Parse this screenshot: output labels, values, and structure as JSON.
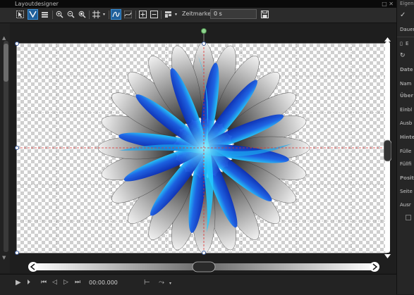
{
  "titlebar": {
    "title": "Layoutdesigner",
    "window_controls": "□ ✕"
  },
  "toolbar": {
    "zeitmarke_label": "Zeitmarke:",
    "zeitmarke_value": "0 s"
  },
  "bottombar": {
    "timecode": "00:00.000"
  },
  "right_panel": {
    "title": "Eigens",
    "tab": "Dauer",
    "doc_label": "E",
    "section_daten": "Date",
    "name_label": "Nam",
    "section_uberblend": "Über",
    "einbl_label": "Einbl",
    "ausbl_label": "Ausb",
    "section_hinter": "Hinte",
    "fulle_label": "Fülle",
    "fullf_label": "Füllfi",
    "section_posit": "Posit",
    "seite_label": "Seite",
    "ausr_label": "Ausr"
  },
  "colors": {
    "accent": "#1f5f9a",
    "guide_red": "#e03030",
    "flower_blue": "#1a4fd8",
    "flower_cyan": "#22c8ff"
  }
}
